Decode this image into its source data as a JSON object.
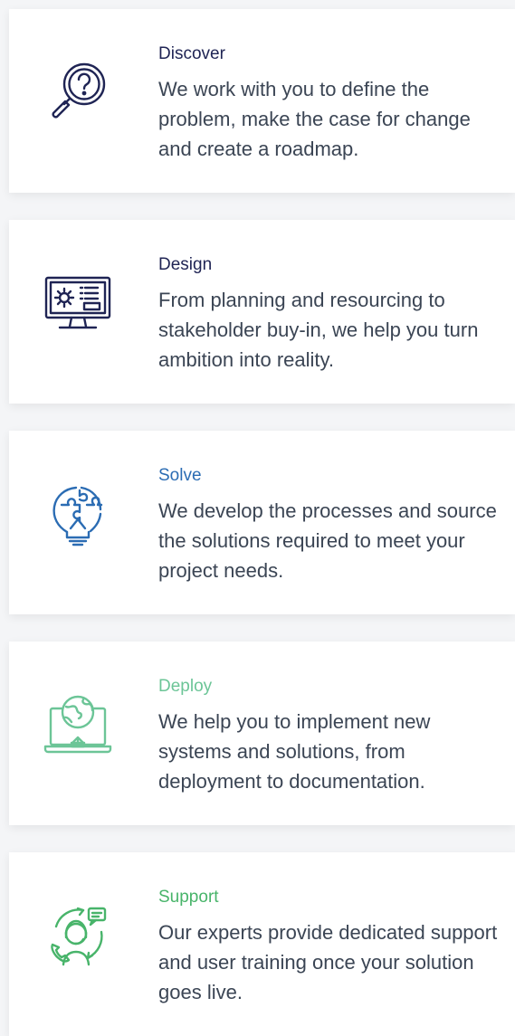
{
  "cards": [
    {
      "title": "Discover",
      "description": "We work with you to define the problem, make the case for change and create a roadmap.",
      "icon": "magnifier-question-icon",
      "color": "#1f2454"
    },
    {
      "title": "Design",
      "description": "From planning and resourcing to stakeholder buy-in, we help you turn ambition into reality.",
      "icon": "monitor-gear-icon",
      "color": "#1f2454"
    },
    {
      "title": "Solve",
      "description": "We develop the processes and source the solutions required to meet your project needs.",
      "icon": "puzzle-bulb-icon",
      "color": "#2b6cb3"
    },
    {
      "title": "Deploy",
      "description": "We help you to implement new systems and solutions, from deployment to documentation.",
      "icon": "laptop-globe-icon",
      "color": "#6cc597"
    },
    {
      "title": "Support",
      "description": "Our experts provide dedicated support and user training once your solution goes live.",
      "icon": "headset-support-icon",
      "color": "#48b46a"
    }
  ]
}
